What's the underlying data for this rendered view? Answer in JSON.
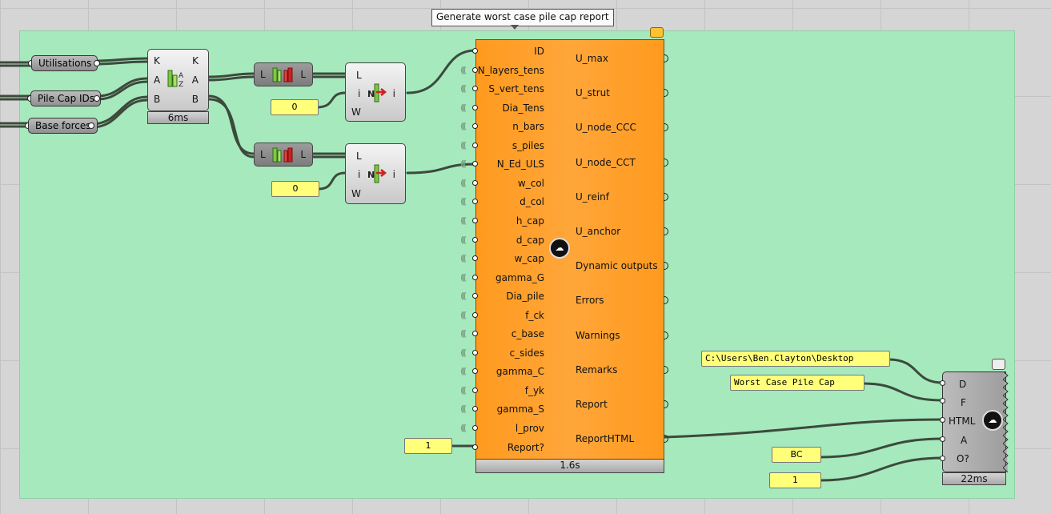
{
  "tooltip": "Generate worst case pile cap report",
  "params": {
    "utilisations": "Utilisations",
    "pile_cap_ids": "Pile Cap IDs",
    "base_forces": "Base forces"
  },
  "sort_component": {
    "inputs": [
      "K",
      "A",
      "B"
    ],
    "outputs": [
      "K",
      "A",
      "B"
    ],
    "timing": "6ms"
  },
  "reverse_component": {
    "input": "L",
    "output": "L"
  },
  "item_component": {
    "inputs": [
      "L",
      "i",
      "W"
    ],
    "output": "i"
  },
  "index_panels": [
    "0",
    "0"
  ],
  "main_component": {
    "inputs": [
      "ID",
      "N_layers_tens",
      "S_vert_tens",
      "Dia_Tens",
      "n_bars",
      "s_piles",
      "N_Ed_ULS",
      "w_col",
      "d_col",
      "h_cap",
      "d_cap",
      "w_cap",
      "gamma_G",
      "Dia_pile",
      "f_ck",
      "c_base",
      "c_sides",
      "gamma_C",
      "f_yk",
      "gamma_S",
      "l_prov",
      "Report?"
    ],
    "outputs": [
      "U_max",
      "U_strut",
      "U_node_CCC",
      "U_node_CCT",
      "U_reinf",
      "U_anchor",
      "Dynamic outputs",
      "Errors",
      "Warnings",
      "Remarks",
      "Report",
      "ReportHTML"
    ],
    "timing": "1.6s",
    "report_toggle": "1"
  },
  "report_component": {
    "inputs": [
      "D",
      "F",
      "HTML",
      "A",
      "O?"
    ],
    "timing": "22ms",
    "path_panel": "C:\\Users\\Ben.Clayton\\Desktop",
    "file_panel": "Worst Case Pile Cap",
    "author_panel": "BC",
    "open_panel": "1"
  },
  "colors": {
    "canvas": "#d5d5d5",
    "group": "#a6e9bd",
    "main": "#ffa63a",
    "panel": "#ffff7a"
  }
}
